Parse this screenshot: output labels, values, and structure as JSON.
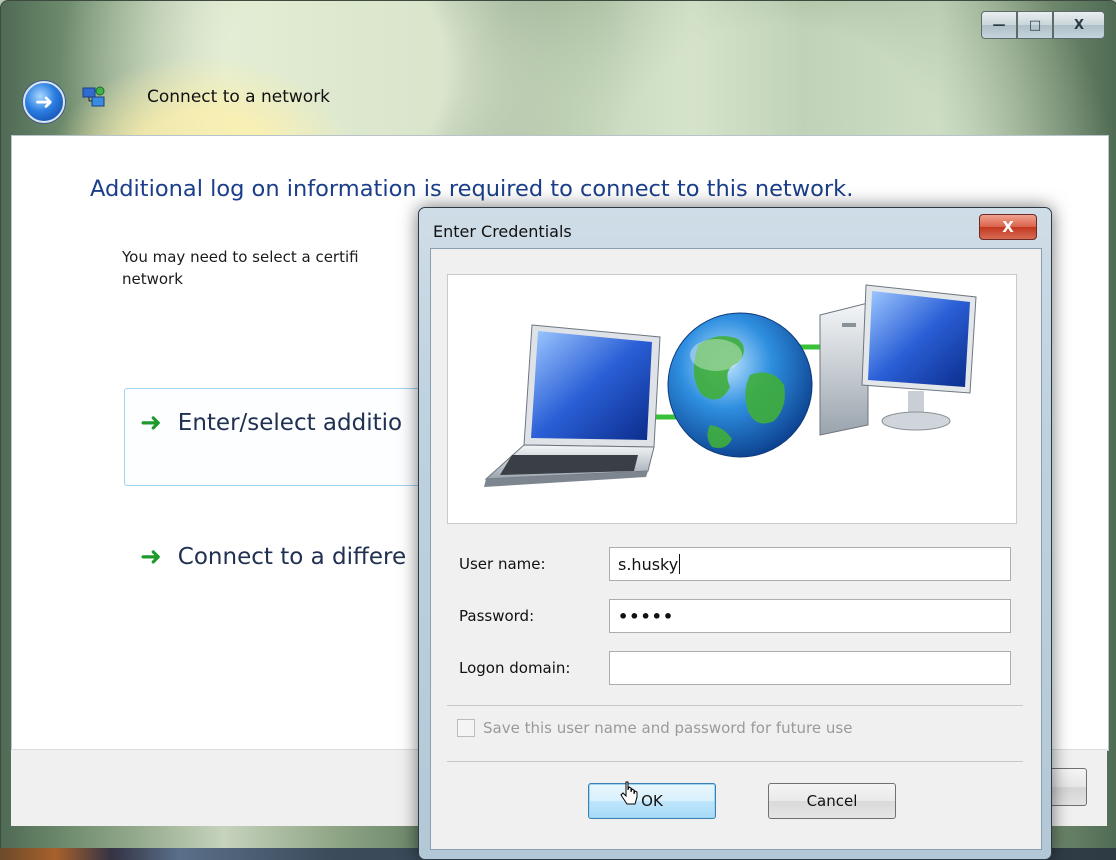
{
  "main_window": {
    "title": "Connect to a network",
    "heading": "Additional log on information is required to connect to this network.",
    "description": "You may need to select a certifi",
    "description_line2": "network",
    "options": [
      {
        "label": "Enter/select additio",
        "icon": "arrow-right-icon"
      },
      {
        "label": "Connect to a differe",
        "icon": "arrow-right-icon"
      }
    ],
    "window_controls": {
      "minimize": "—",
      "maximize": "□",
      "close": "X"
    }
  },
  "dialog": {
    "title": "Enter Credentials",
    "close_label": "X",
    "fields": {
      "username_label": "User name:",
      "username_value": "s.husky",
      "password_label": "Password:",
      "password_value": "•••••",
      "domain_label": "Logon domain:",
      "domain_value": ""
    },
    "save_checkbox_label": "Save this user name and password for future use",
    "save_checked": false,
    "ok_label": "OK",
    "cancel_label": "Cancel"
  },
  "colors": {
    "heading": "#1a3e8a",
    "option_border": "#9fd3ef",
    "close_button": "#c2381f",
    "default_button": "#3c7fb1"
  }
}
